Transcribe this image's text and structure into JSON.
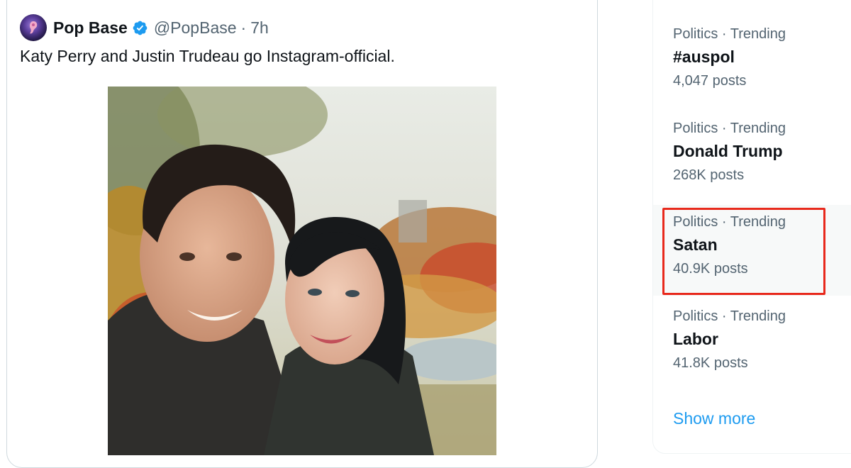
{
  "tweet": {
    "display_name": "Pop Base",
    "handle": "@PopBase",
    "separator": "·",
    "time": "7h",
    "text": "Katy Perry and Justin Trudeau go Instagram-official.",
    "verified_color": "#1d9bf0",
    "photo_icon": "selfie-photo"
  },
  "trends": {
    "items": [
      {
        "meta": "Politics · Trending",
        "name": "#auspol",
        "count": "4,047 posts"
      },
      {
        "meta": "Politics · Trending",
        "name": "Donald Trump",
        "count": "268K posts"
      },
      {
        "meta": "Politics · Trending",
        "name": "Satan",
        "count": "40.9K posts"
      },
      {
        "meta": "Politics · Trending",
        "name": "Labor",
        "count": "41.8K posts"
      }
    ],
    "show_more": "Show more",
    "highlight_color": "#e8291c",
    "link_color": "#1d9bf0"
  }
}
